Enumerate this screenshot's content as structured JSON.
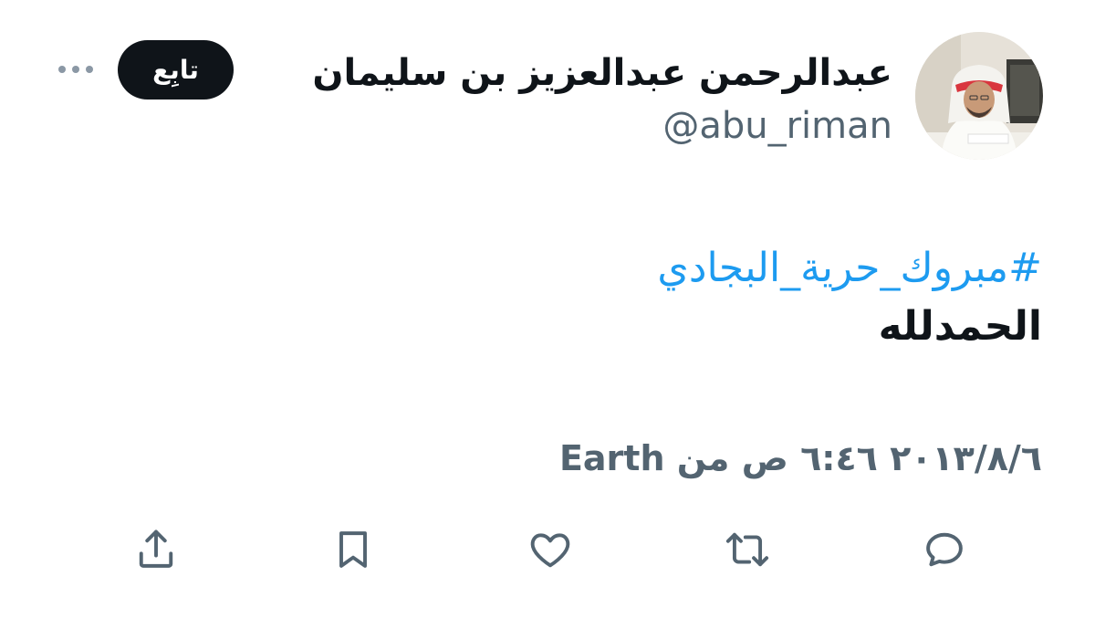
{
  "user": {
    "display_name": "عبدالرحمن عبدالعزيز بن سليمان",
    "handle": "@abu_riman",
    "avatar_icon": "profile-photo"
  },
  "header": {
    "follow_label": "تابِع",
    "more_icon": "more-dots-icon"
  },
  "tweet": {
    "hashtag": "#مبروك_حرية_البجادي",
    "text": "الحمدلله"
  },
  "meta": {
    "date": "٢٠١٣/٨/٦",
    "time": "٦:٤٦ ص",
    "from": "من",
    "source": "Earth"
  },
  "actions": [
    {
      "name": "reply",
      "icon": "reply-icon"
    },
    {
      "name": "retweet",
      "icon": "retweet-icon"
    },
    {
      "name": "like",
      "icon": "heart-icon"
    },
    {
      "name": "bookmark",
      "icon": "bookmark-icon"
    },
    {
      "name": "share",
      "icon": "share-icon"
    }
  ],
  "colors": {
    "accent": "#1d9bf0",
    "text": "#0f1419",
    "muted": "#536471",
    "follow_bg": "#0f1419"
  }
}
